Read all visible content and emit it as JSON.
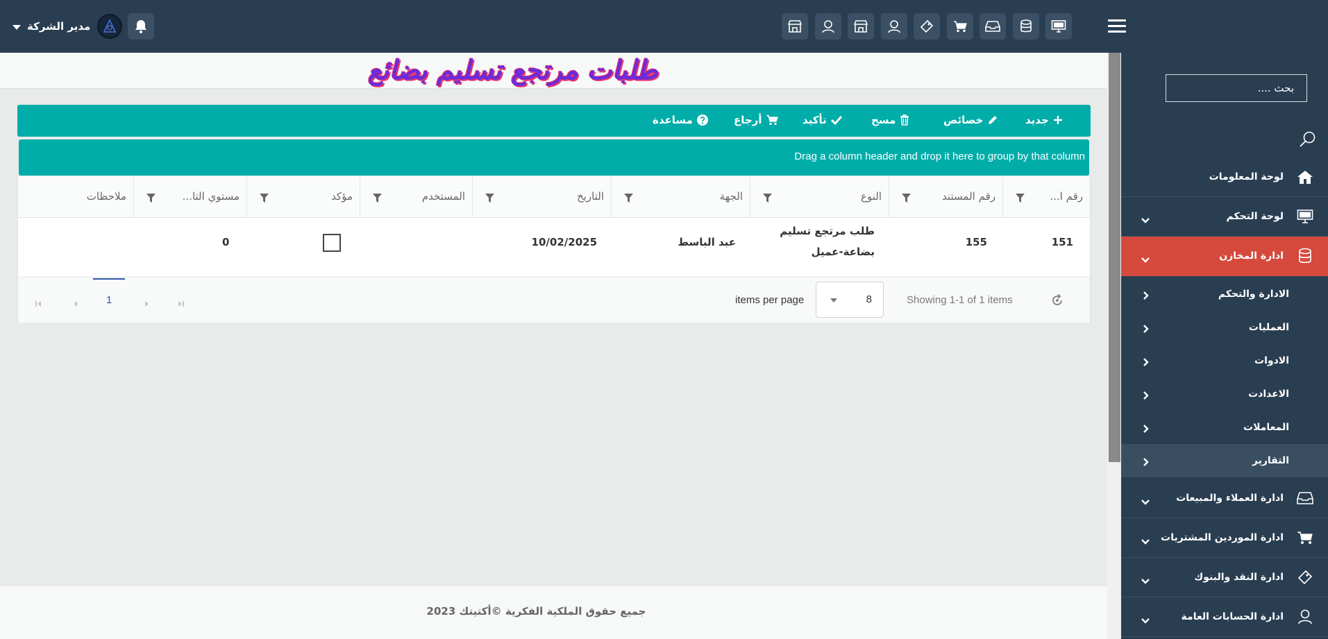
{
  "header": {
    "user_name": "مدير الشركة",
    "icons": [
      "monitor-icon",
      "database-icon",
      "inbox-icon",
      "cart-icon",
      "tag-icon",
      "user-icon",
      "store-icon",
      "user-icon",
      "store-icon"
    ]
  },
  "sidebar": {
    "search_placeholder": "بحث ....",
    "items": [
      {
        "label": "لوحة المعلومات",
        "icon": "home-icon"
      },
      {
        "label": "لوحة التحكم",
        "icon": "monitor-icon"
      },
      {
        "label": "ادارة المخازن",
        "icon": "database-icon"
      },
      {
        "label": "ادارة العملاء والمبيعات",
        "icon": "inbox-icon"
      },
      {
        "label": "ادارة الموردين المشتريات",
        "icon": "cart-icon"
      },
      {
        "label": "ادارة النقد والبنوك",
        "icon": "tag-icon"
      },
      {
        "label": "ادارة الحسابات العامة",
        "icon": "user-icon"
      }
    ],
    "subitems": [
      {
        "label": "الادارة والتحكم"
      },
      {
        "label": "العمليات"
      },
      {
        "label": "الادوات"
      },
      {
        "label": "الاعدادت"
      },
      {
        "label": "المعاملات"
      },
      {
        "label": "التقارير"
      }
    ]
  },
  "page": {
    "title": "طلبات مرتجع تسليم بضائع"
  },
  "toolbar": {
    "new": "جديد",
    "properties": "خصائص",
    "delete": "مسح",
    "confirm": "تأكيد",
    "return": "أرجاع",
    "help": "مساعدة"
  },
  "grid": {
    "group_hint": "Drag a column header and drop it here to group by that column",
    "columns": [
      "رقم ا...",
      "رقم المستند",
      "النوع",
      "الجهة",
      "التاريخ",
      "المستخدم",
      "مؤكد",
      "مستوي التا...",
      "ملاحظات"
    ],
    "rows": [
      {
        "id": "151",
        "doc_no": "155",
        "type_line1": "طلب مرتجع تسليم",
        "type_line2": "بضاعة-عميل",
        "party": "عبد الباسط",
        "date": "10/02/2025",
        "user": "",
        "confirmed": false,
        "level": "0",
        "notes": ""
      }
    ],
    "pager": {
      "current_page": "1",
      "per_page": "8",
      "per_page_label": "items per page",
      "showing": "Showing 1-1 of 1 items"
    }
  },
  "footer": {
    "copyright": "جميع حقوق الملكية الفكرية ©أكتيتك 2023"
  },
  "colors": {
    "topbar": "#2a3e52",
    "accent_teal": "#00ada9",
    "active_red": "#d54a3c"
  }
}
